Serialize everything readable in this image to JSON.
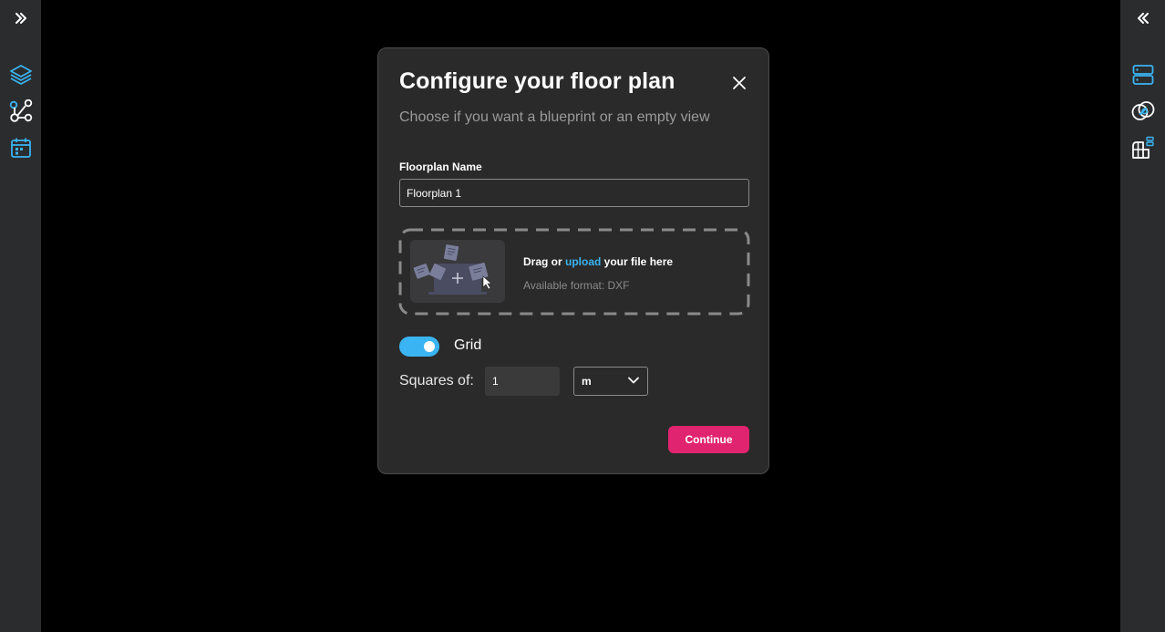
{
  "colors": {
    "accent_blue": "#3ab4f2",
    "primary_button": "#e0246f",
    "rail_bg": "#2b2c2e",
    "modal_bg": "#2a2a2a"
  },
  "left_rail": {
    "items": [
      {
        "icon": "chevrons-right-icon"
      },
      {
        "icon": "layers-icon"
      },
      {
        "icon": "graph-nodes-icon"
      },
      {
        "icon": "calendar-icon"
      }
    ]
  },
  "right_rail": {
    "items": [
      {
        "icon": "chevrons-left-icon"
      },
      {
        "icon": "server-list-icon"
      },
      {
        "icon": "link-circles-icon"
      },
      {
        "icon": "room-add-icon"
      }
    ]
  },
  "modal": {
    "title": "Configure your floor plan",
    "subtitle": "Choose if you want a blueprint or an empty view",
    "name_field": {
      "label": "Floorplan Name",
      "value": "Floorplan 1"
    },
    "dropzone": {
      "text_prefix": "Drag or ",
      "link_text": "upload",
      "text_suffix": " your file here",
      "format_text": "Available format: DXF"
    },
    "grid_toggle": {
      "label": "Grid",
      "enabled": true
    },
    "squares": {
      "label": "Squares of:",
      "value": "1",
      "unit": "m"
    },
    "continue_label": "Continue"
  }
}
